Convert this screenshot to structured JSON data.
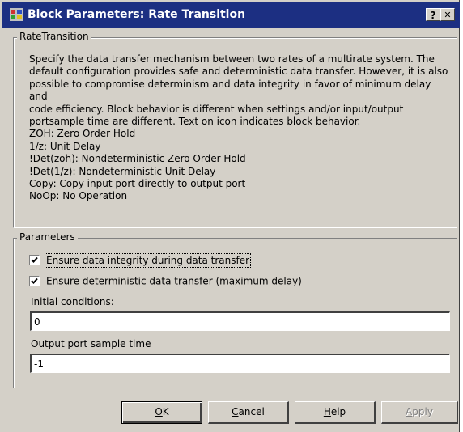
{
  "window": {
    "title": "Block Parameters: Rate Transition",
    "help_button": "?",
    "close_button": "✕"
  },
  "description_group": {
    "legend": "RateTransition",
    "lines": [
      "Specify the data transfer mechanism between two rates of a multirate system. The",
      "default configuration provides safe and deterministic data transfer. However, it is also",
      "possible to compromise determinism and data integrity in favor of minimum delay and",
      "code efficiency. Block behavior is different when settings and/or input/output",
      "portsample time are different. Text on icon indicates block behavior.",
      "ZOH: Zero Order Hold",
      "1/z: Unit Delay",
      "!Det(zoh): Nondeterministic Zero Order Hold",
      "!Det(1/z): Nondeterministic Unit Delay",
      "Copy: Copy input port directly to output port",
      "NoOp: No Operation"
    ]
  },
  "parameters_group": {
    "legend": "Parameters",
    "ensure_integrity": {
      "label": "Ensure data integrity during data transfer",
      "checked": true
    },
    "ensure_deterministic": {
      "label": "Ensure deterministic data transfer (maximum delay)",
      "checked": true
    },
    "initial_conditions": {
      "label": "Initial conditions:",
      "value": "0"
    },
    "output_port_sample_time": {
      "label": "Output port sample time",
      "value": "-1"
    }
  },
  "buttons": {
    "ok": {
      "accel": "O",
      "rest": "K"
    },
    "cancel": {
      "accel": "C",
      "rest": "ancel"
    },
    "help": {
      "accel": "H",
      "rest": "elp"
    },
    "apply": {
      "accel": "A",
      "rest": "pply",
      "enabled": false
    }
  }
}
